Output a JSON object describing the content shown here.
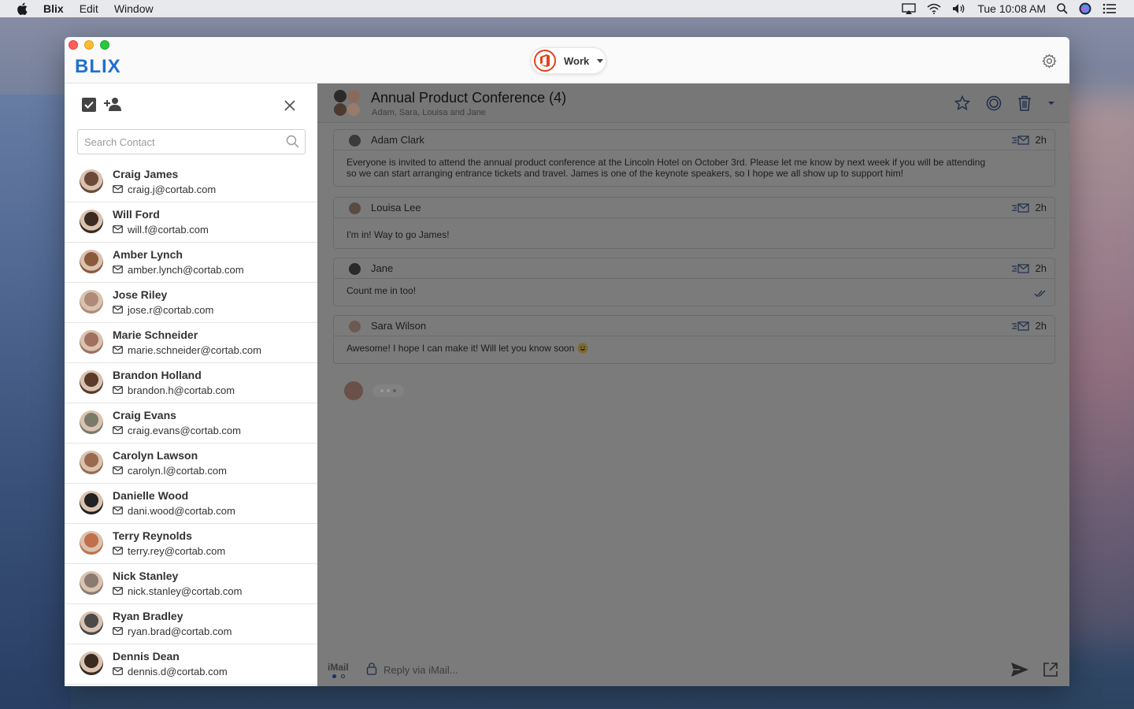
{
  "menubar": {
    "app": "Blix",
    "items": [
      "Edit",
      "Window"
    ],
    "clock": "Tue 10:08 AM"
  },
  "app": {
    "logo": "BLIX",
    "account": {
      "label": "Work",
      "icon": "office-icon"
    }
  },
  "contacts": {
    "search_placeholder": "Search Contact",
    "list": [
      {
        "name": "Craig James",
        "email": "craig.j@cortab.com",
        "color": "#6b4a3a"
      },
      {
        "name": "Will Ford",
        "email": "will.f@cortab.com",
        "color": "#3b2b23"
      },
      {
        "name": "Amber Lynch",
        "email": "amber.lynch@cortab.com",
        "color": "#8a5a3c"
      },
      {
        "name": "Jose Riley",
        "email": "jose.r@cortab.com",
        "color": "#b08a78"
      },
      {
        "name": "Marie Schneider",
        "email": "marie.schneider@cortab.com",
        "color": "#a07060"
      },
      {
        "name": "Brandon Holland",
        "email": "brandon.h@cortab.com",
        "color": "#5a3a2a"
      },
      {
        "name": "Craig Evans",
        "email": "craig.evans@cortab.com",
        "color": "#7a7a6a"
      },
      {
        "name": "Carolyn Lawson",
        "email": "carolyn.l@cortab.com",
        "color": "#9a6a50"
      },
      {
        "name": "Danielle Wood",
        "email": "dani.wood@cortab.com",
        "color": "#222222"
      },
      {
        "name": "Terry Reynolds",
        "email": "terry.rey@cortab.com",
        "color": "#c0704a"
      },
      {
        "name": "Nick Stanley",
        "email": "nick.stanley@cortab.com",
        "color": "#8a7a70"
      },
      {
        "name": "Ryan Bradley",
        "email": "ryan.brad@cortab.com",
        "color": "#4a4a4a"
      },
      {
        "name": "Dennis Dean",
        "email": "dennis.d@cortab.com",
        "color": "#3a2a20"
      }
    ]
  },
  "thread": {
    "title": "Annual Product Conference (4)",
    "participants": "Adam, Sara, Louisa and Jane",
    "messages": [
      {
        "sender": "Adam Clark",
        "time": "2h",
        "color": "#3a3a3a",
        "body_line1": "Everyone is invited to attend the annual product conference at the Lincoln Hotel on October 3rd. Please let me know by next week if you will be attending",
        "body_line2": "so we can start arranging entrance tickets and travel. James is one of the keynote speakers, so I hope we all show up to support him!"
      },
      {
        "sender": "Louisa Lee",
        "time": "2h",
        "color": "#5a4a40",
        "body_line1": "I'm in! Way to go James!"
      },
      {
        "sender": "Jane",
        "time": "2h",
        "color": "#2a2a2a",
        "body_line1": "Count me in too!"
      },
      {
        "sender": "Sara Wilson",
        "time": "2h",
        "color": "#6a5a50",
        "body_line1": "Awesome! I hope I can make it! Will let you know soon"
      }
    ]
  },
  "reply": {
    "channel": "iMail",
    "placeholder": "Reply via iMail..."
  }
}
